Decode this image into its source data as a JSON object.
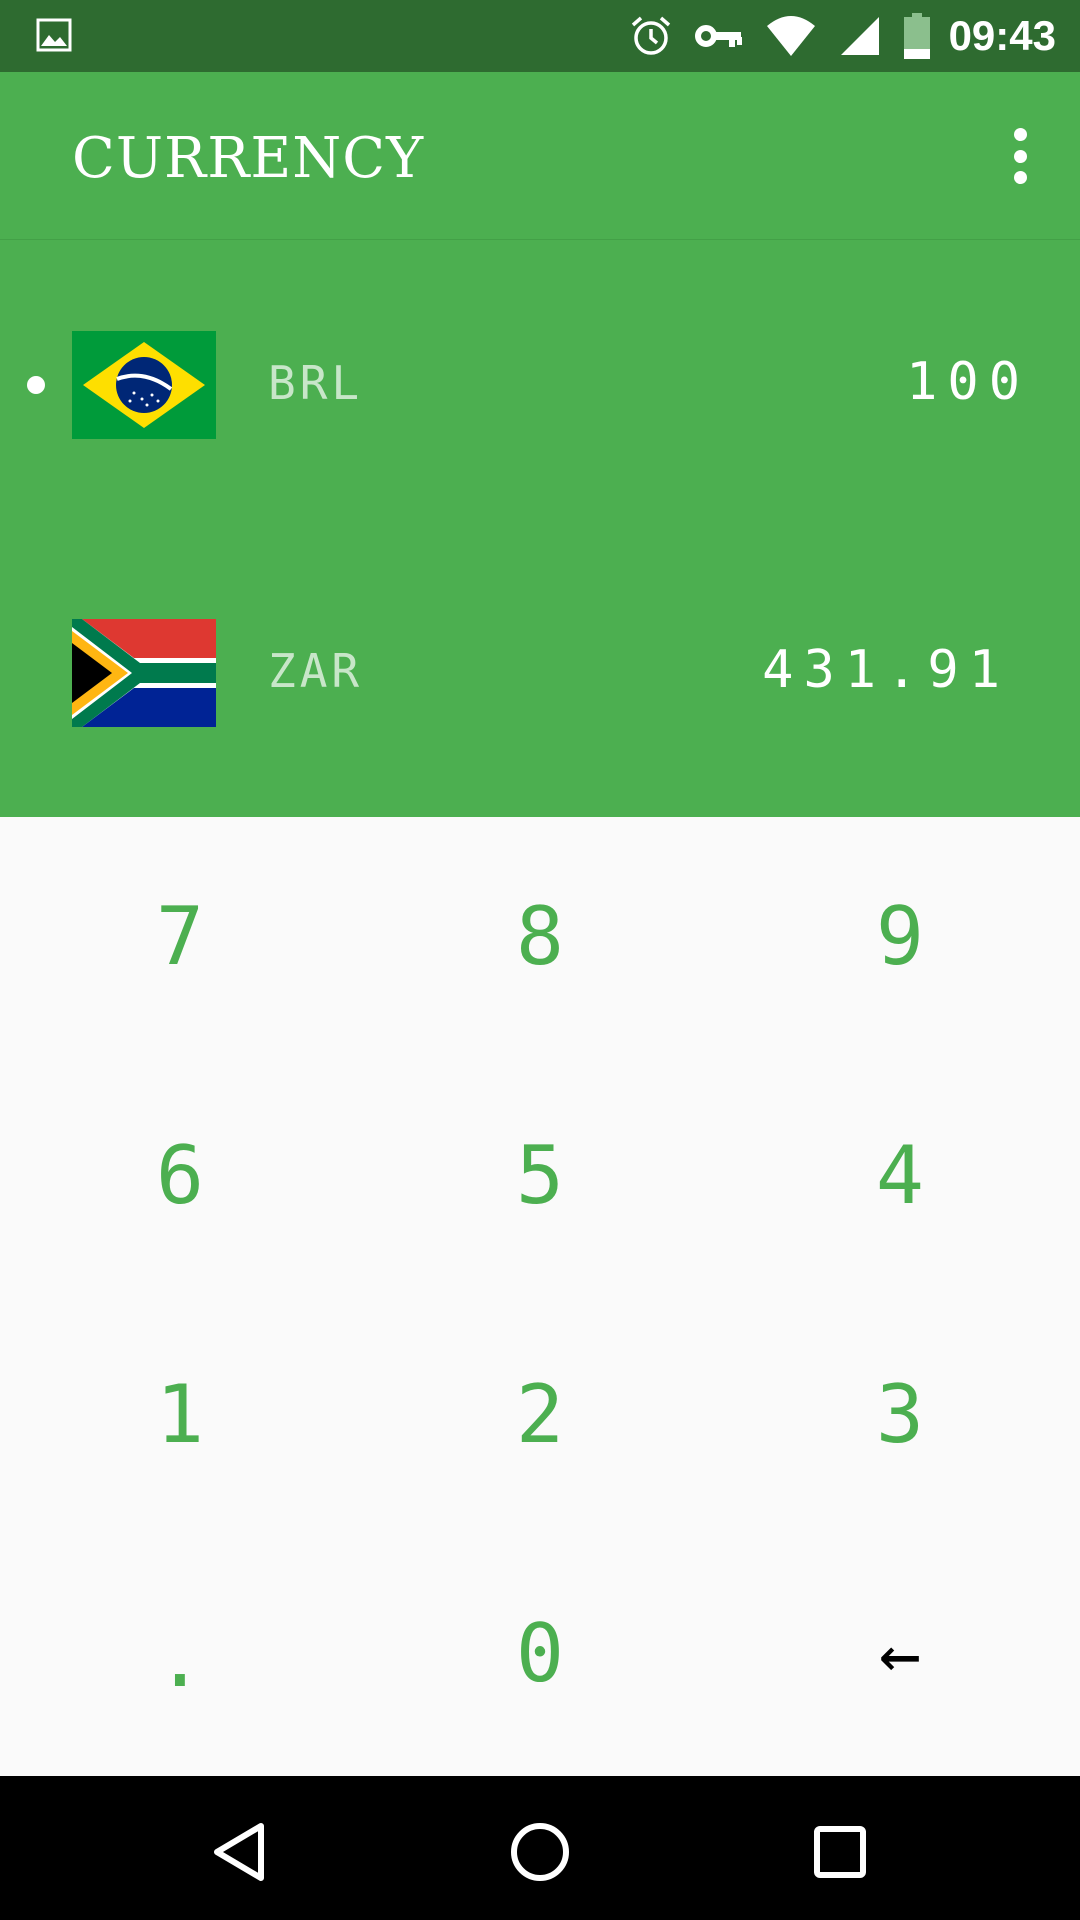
{
  "status_bar": {
    "time": "09:43",
    "icons": [
      "image-icon",
      "alarm-icon",
      "vpn-key-icon",
      "wifi-icon",
      "signal-icon",
      "battery-icon"
    ]
  },
  "app_bar": {
    "title": "CURRENCY",
    "menu_icon": "more-vertical-icon"
  },
  "currencies": [
    {
      "code": "BRL",
      "amount": "100",
      "flag": "brazil-flag",
      "selected": true
    },
    {
      "code": "ZAR",
      "amount": "431.91",
      "flag": "south-africa-flag",
      "selected": false
    }
  ],
  "keypad": {
    "keys": [
      "7",
      "8",
      "9",
      "6",
      "5",
      "4",
      "1",
      "2",
      "3",
      ".",
      "0",
      "←"
    ]
  },
  "colors": {
    "primary": "#4caf50",
    "primary_dark": "#2e6b30",
    "keypad_bg": "#fafafa"
  },
  "nav_bar": {
    "buttons": [
      "back-icon",
      "home-icon",
      "recents-icon"
    ]
  }
}
